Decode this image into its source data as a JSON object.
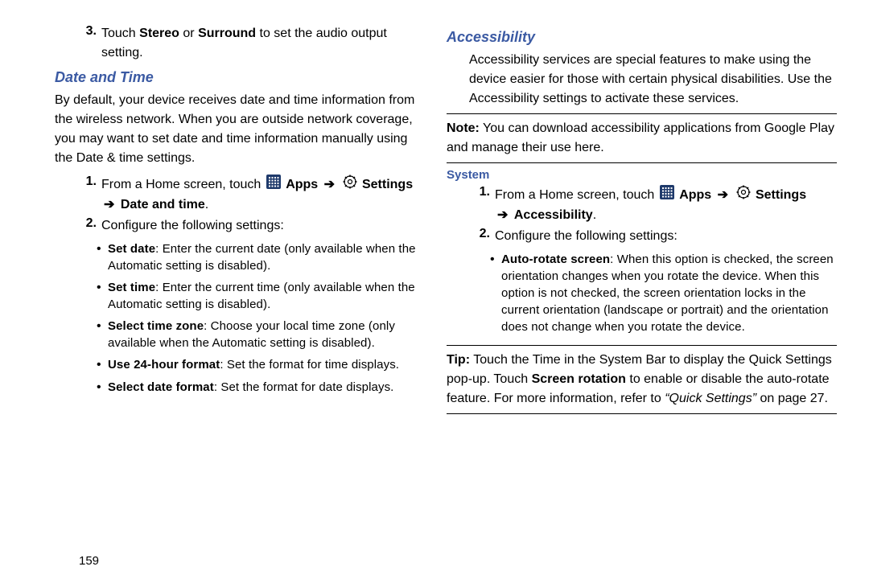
{
  "left": {
    "step3_num": "3.",
    "step3_a": "Touch ",
    "step3_b": "Stereo",
    "step3_c": " or ",
    "step3_d": "Surround",
    "step3_e": " to set the audio output setting.",
    "h_datetime": "Date and Time",
    "dt_intro": "By default, your device receives date and time information from the wireless network. When you are outside network coverage, you may want to set date and time information manually using the Date & time settings.",
    "s1_num": "1.",
    "s1_a": "From a Home screen, touch ",
    "s1_apps": "Apps",
    "s1_settings": "Settings",
    "s1_last": "Date and time",
    "s2_num": "2.",
    "s2_a": "Configure the following settings:",
    "bul": {
      "setdate_b": "Set date",
      "setdate_t": ": Enter the current date (only available when the Automatic setting is disabled).",
      "settime_b": "Set time",
      "settime_t": ": Enter the current time (only available when the Automatic setting is disabled).",
      "tz_b": "Select time zone",
      "tz_t": ": Choose your local time zone (only available when the Automatic setting is disabled).",
      "fmt24_b": "Use 24-hour format",
      "fmt24_t": ": Set the format for time displays.",
      "dfmt_b": "Select date format",
      "dfmt_t": ": Set the format for date displays."
    },
    "page_num": "159"
  },
  "right": {
    "h_access": "Accessibility",
    "access_intro": "Accessibility services are special features to make using the device easier for those with certain physical disabilities. Use the Accessibility settings to activate these services.",
    "note_label": "Note:",
    "note_body": " You can download accessibility applications from Google Play and manage their use here.",
    "h_system": "System",
    "s1_num": "1.",
    "s1_a": "From a Home screen, touch ",
    "s1_apps": "Apps",
    "s1_settings": "Settings",
    "s1_last": "Accessibility",
    "s2_num": "2.",
    "s2_a": "Configure the following settings:",
    "bul": {
      "auto_b": "Auto-rotate screen",
      "auto_t": ": When this option is checked, the screen orientation changes when you rotate the device. When this option is not checked, the screen orientation locks in the current orientation (landscape or portrait) and the orientation does not change when you rotate the device."
    },
    "tip_label": "Tip:",
    "tip_a": " Touch the Time in the System Bar to display the Quick Settings pop-up. Touch ",
    "tip_b": "Screen rotation",
    "tip_c": " to enable or disable the auto-rotate feature. For more information, refer to ",
    "tip_ref": "“Quick Settings”",
    "tip_d": " on page 27."
  },
  "glyphs": {
    "arrow": "➔",
    "bullet": "•",
    "period": "."
  }
}
